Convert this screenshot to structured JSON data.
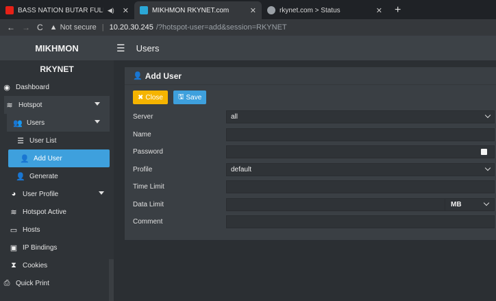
{
  "browser": {
    "tabs": [
      {
        "title": "BASS NATION BUTAR FULL /",
        "favicon_color": "#e62117",
        "icon": "youtube-icon",
        "active": false
      },
      {
        "title": "MIKHMON RKYNET.com",
        "favicon_color": "#2ba7d6",
        "icon": "mikhmon-favicon-icon",
        "active": true
      },
      {
        "title": "rkynet.com > Status",
        "favicon_color": "#9aa0a6",
        "icon": "globe-icon",
        "active": false
      }
    ],
    "new_tab": "+",
    "security_label": "Not secure",
    "url_host": "10.20.30.245",
    "url_path": "/?hotspot-user=add&session=RKYNET"
  },
  "app": {
    "brand": "MIKHMON",
    "header_title": "Users"
  },
  "sidebar": {
    "session": "RKYNET",
    "items": [
      {
        "label": "Dashboard",
        "icon": "dashboard-icon"
      },
      {
        "label": "Hotspot",
        "icon": "wifi-icon"
      },
      {
        "label": "Users",
        "icon": "users-icon"
      },
      {
        "label": "User List",
        "icon": "list-icon"
      },
      {
        "label": "Add User",
        "icon": "user-plus-icon"
      },
      {
        "label": "Generate",
        "icon": "user-plus-icon"
      },
      {
        "label": "User Profile",
        "icon": "pie-chart-icon"
      },
      {
        "label": "Hotspot Active",
        "icon": "wifi-icon"
      },
      {
        "label": "Hosts",
        "icon": "laptop-icon"
      },
      {
        "label": "IP Bindings",
        "icon": "address-card-icon"
      },
      {
        "label": "Cookies",
        "icon": "hourglass-icon"
      },
      {
        "label": "Quick Print",
        "icon": "print-icon"
      }
    ]
  },
  "card": {
    "title": "Add User",
    "close_label": "Close",
    "save_label": "Save",
    "fields": {
      "server": {
        "label": "Server",
        "value": "all"
      },
      "name": {
        "label": "Name",
        "value": ""
      },
      "password": {
        "label": "Password",
        "value": ""
      },
      "profile": {
        "label": "Profile",
        "value": "default"
      },
      "time_limit": {
        "label": "Time Limit",
        "value": ""
      },
      "data_limit": {
        "label": "Data Limit",
        "value": "",
        "unit": "MB"
      },
      "comment": {
        "label": "Comment",
        "value": ""
      }
    }
  },
  "colors": {
    "accent": "#3ea0dd",
    "close_button": "#f5b400",
    "sidebar_bg": "#2f3337",
    "card_bg": "#3a3f44"
  }
}
